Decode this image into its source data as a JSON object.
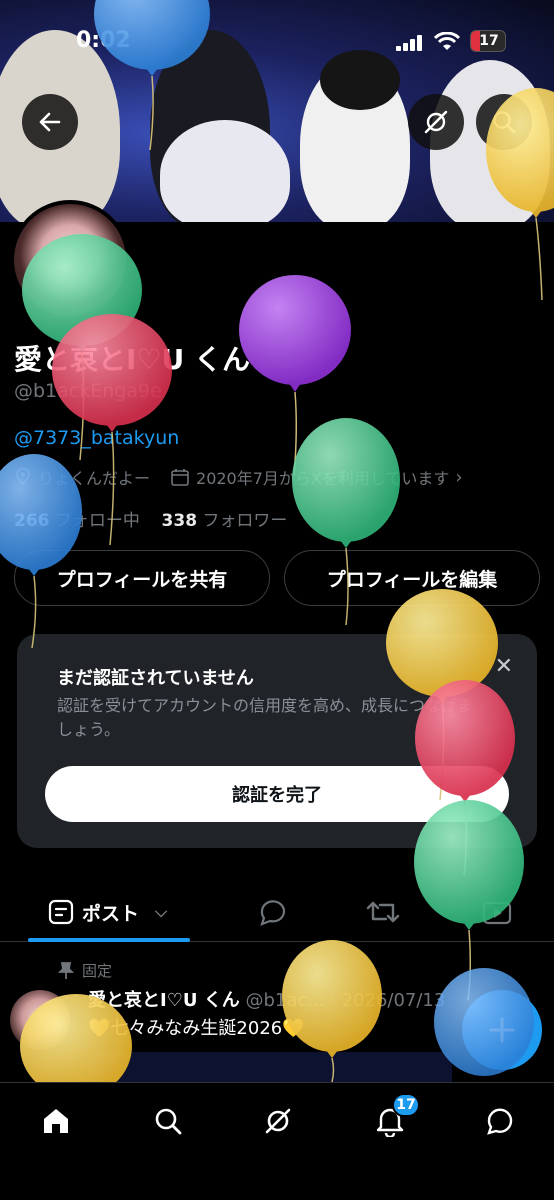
{
  "status_bar": {
    "time": "0:02",
    "battery": "17"
  },
  "profile": {
    "display_name": "愛と哀とI♡U くん",
    "handle": "@b1ackEnga9e",
    "bio_link": "@7373_batakyun",
    "location": "りょくんだよー",
    "joined": "2020年7月からXを利用しています",
    "following_count": "266",
    "following_label": "フォロー中",
    "followers_count": "338",
    "followers_label": "フォロワー"
  },
  "buttons": {
    "share_profile": "プロフィールを共有",
    "edit_profile": "プロフィールを編集"
  },
  "verify_card": {
    "title": "まだ認証されていません",
    "description": "認証を受けてアカウントの信用度を高め、成長につなげましょう。",
    "cta": "認証を完了"
  },
  "tabs": {
    "posts": "ポスト"
  },
  "pinned_post": {
    "pinned_label": "固定",
    "author": "愛と哀とI♡U くん",
    "handle_date": "@b1ac... · 2026/07/13",
    "text": "💛七々みなみ生誕2026💛"
  },
  "nav": {
    "notifications_badge": "17"
  },
  "colors": {
    "accent": "#1d9bf0",
    "balloon_red": "#e8445f",
    "balloon_green": "#3ec58a",
    "balloon_yellow": "#f0c53c",
    "balloon_purple": "#9a3fd6",
    "balloon_blue": "#3b8fe0"
  }
}
